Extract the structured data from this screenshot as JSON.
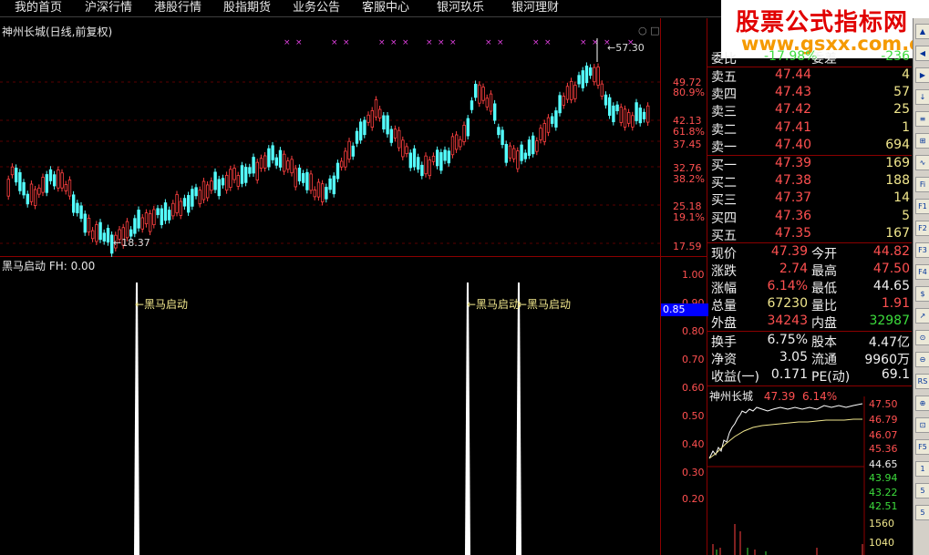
{
  "menu": [
    "我的首页",
    "沪深行情",
    "港股行情",
    "股指期货",
    "业务公告",
    "客服中心",
    "银河玖乐",
    "银河理财"
  ],
  "watermark": {
    "title": "股票公式指标网",
    "url": "www.gsxx.com.cn"
  },
  "stock": {
    "title": "神州长城(日线,前复权)",
    "high_mark": "57.30",
    "low_mark": "18.37"
  },
  "price_axis": [
    {
      "value": "49.72",
      "pct": "80.9%"
    },
    {
      "value": "42.13",
      "pct": "61.8%"
    },
    {
      "value": "37.45",
      "pct": ""
    },
    {
      "value": "32.76",
      "pct": "38.2%"
    },
    {
      "value": "25.18",
      "pct": "19.1%"
    },
    {
      "value": "17.59",
      "pct": ""
    }
  ],
  "indicator": {
    "title": "黑马启动 FH: 0.00",
    "signal_label": "←黑马启动",
    "axis": [
      "1.00",
      "0.90",
      "0.80",
      "0.70",
      "0.60",
      "0.50",
      "0.40",
      "0.30",
      "0.20"
    ],
    "cursor_value": "0.85"
  },
  "quote": {
    "weibi": {
      "label": "委比",
      "value": "-17.98%",
      "label2": "委差",
      "value2": "-236"
    },
    "asks": [
      {
        "label": "卖五",
        "price": "47.44",
        "vol": "4"
      },
      {
        "label": "卖四",
        "price": "47.43",
        "vol": "57"
      },
      {
        "label": "卖三",
        "price": "47.42",
        "vol": "25"
      },
      {
        "label": "卖二",
        "price": "47.41",
        "vol": "1"
      },
      {
        "label": "卖一",
        "price": "47.40",
        "vol": "694"
      }
    ],
    "bids": [
      {
        "label": "买一",
        "price": "47.39",
        "vol": "169"
      },
      {
        "label": "买二",
        "price": "47.38",
        "vol": "188"
      },
      {
        "label": "买三",
        "price": "47.37",
        "vol": "14"
      },
      {
        "label": "买四",
        "price": "47.36",
        "vol": "5"
      },
      {
        "label": "买五",
        "price": "47.35",
        "vol": "167"
      }
    ],
    "stats": [
      {
        "l1": "现价",
        "v1": "47.39",
        "l2": "今开",
        "v2": "44.82"
      },
      {
        "l1": "涨跌",
        "v1": "2.74",
        "l2": "最高",
        "v2": "47.50"
      },
      {
        "l1": "涨幅",
        "v1": "6.14%",
        "l2": "最低",
        "v2": "44.65"
      },
      {
        "l1": "总量",
        "v1": "67230",
        "l2": "量比",
        "v2": "1.91"
      },
      {
        "l1": "外盘",
        "v1": "34243",
        "l2": "内盘",
        "v2": "32987"
      }
    ],
    "fund": [
      {
        "l1": "换手",
        "v1": "6.75%",
        "l2": "股本",
        "v2": "4.47亿"
      },
      {
        "l1": "净资",
        "v1": "3.05",
        "l2": "流通",
        "v2": "9960万"
      },
      {
        "l1": "收益(一)",
        "v1": "0.171",
        "l2": "PE(动)",
        "v2": "69.1"
      }
    ]
  },
  "mini": {
    "name": "神州长城",
    "price": "47.39",
    "pct": "6.14%",
    "axis_up": [
      "47.50",
      "46.79",
      "46.07",
      "45.36"
    ],
    "axis_mid": "44.65",
    "axis_dn": [
      "43.94",
      "43.22",
      "42.51"
    ],
    "vol_axis": [
      "1560",
      "1040"
    ]
  },
  "toolbar": [
    "▲",
    "◀",
    "▶",
    "↓",
    "≡",
    "⊞",
    "∿",
    "Fi",
    "F1",
    "F2",
    "F3",
    "F4",
    "$",
    "↗",
    "⊙",
    "⊖",
    "RS",
    "⊕",
    "⊡",
    "F5",
    "1",
    "5",
    "5"
  ],
  "colors": {
    "up": "#ff4040",
    "down": "#54ffff",
    "signal": "#ffffff",
    "frame": "#8b0000",
    "accent": "#e10000"
  }
}
